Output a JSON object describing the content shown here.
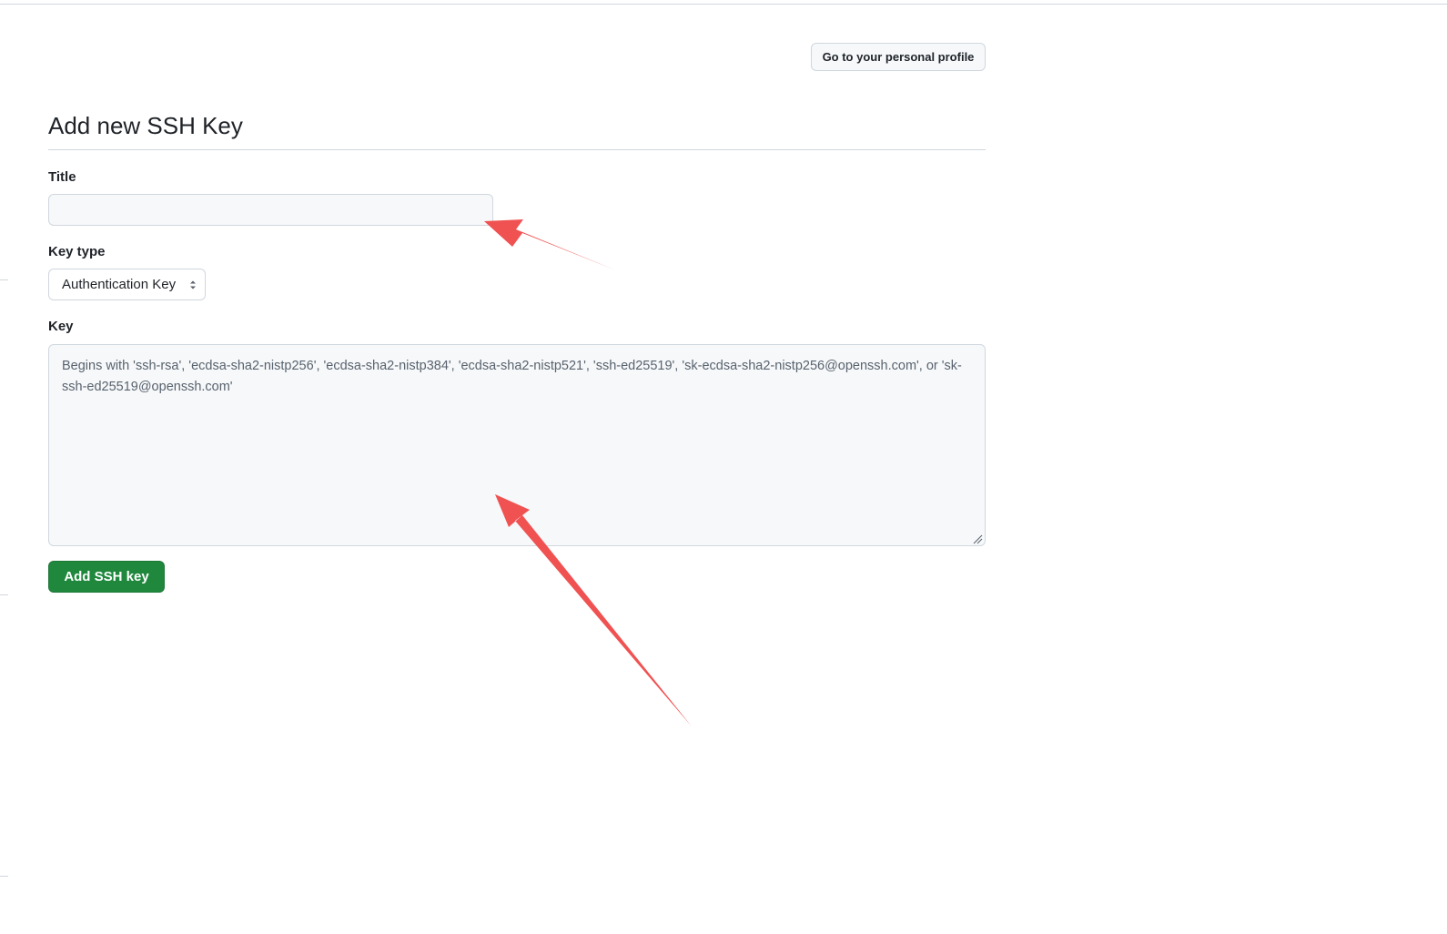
{
  "header": {
    "profile_button": "Go to your personal profile"
  },
  "form": {
    "heading": "Add new SSH Key",
    "title_label": "Title",
    "title_value": "",
    "key_type_label": "Key type",
    "key_type_selected": "Authentication Key",
    "key_label": "Key",
    "key_value": "",
    "key_placeholder": "Begins with 'ssh-rsa', 'ecdsa-sha2-nistp256', 'ecdsa-sha2-nistp384', 'ecdsa-sha2-nistp521', 'ssh-ed25519', 'sk-ecdsa-sha2-nistp256@openssh.com', or 'sk-ssh-ed25519@openssh.com'",
    "submit_label": "Add SSH key"
  },
  "colors": {
    "primary_button": "#1f883d",
    "annotation_arrow": "#f05252",
    "border": "#d0d7de"
  }
}
